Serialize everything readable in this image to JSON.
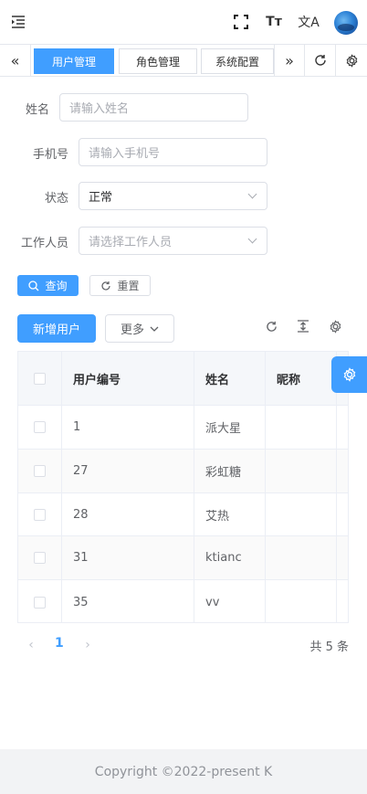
{
  "header": {
    "icons": [
      "menu-fold-icon",
      "fullscreen-icon",
      "font-size-icon",
      "translate-icon",
      "avatar"
    ],
    "font_size_glyph": "Tт",
    "lang_glyph": "文A"
  },
  "tabs": {
    "items": [
      {
        "label": "用户管理",
        "active": true
      },
      {
        "label": "角色管理",
        "active": false
      },
      {
        "label": "系统配置",
        "active": false
      }
    ]
  },
  "search_form": {
    "name": {
      "label": "姓名",
      "placeholder": "请输入姓名"
    },
    "phone": {
      "label": "手机号",
      "placeholder": "请输入手机号"
    },
    "status": {
      "label": "状态",
      "value": "正常"
    },
    "worker": {
      "label": "工作人员",
      "placeholder": "请选择工作人员"
    },
    "query_label": "查询",
    "reset_label": "重置"
  },
  "toolbar": {
    "add_label": "新增用户",
    "more_label": "更多"
  },
  "table": {
    "columns": [
      "用户编号",
      "姓名",
      "昵称"
    ],
    "rows": [
      {
        "id": "1",
        "name": "派大星",
        "nickname": ""
      },
      {
        "id": "27",
        "name": "彩虹糖",
        "nickname": ""
      },
      {
        "id": "28",
        "name": "艾热",
        "nickname": ""
      },
      {
        "id": "31",
        "name": "ktianc",
        "nickname": ""
      },
      {
        "id": "35",
        "name": "vv",
        "nickname": ""
      }
    ]
  },
  "pagination": {
    "current_page": "1",
    "total_text": "共 5 条"
  },
  "footer": {
    "copyright": "Copyright ©2022-present K"
  },
  "colors": {
    "primary": "#409eff",
    "border": "#dcdfe6",
    "text": "#303133",
    "muted": "#a8abb2"
  }
}
